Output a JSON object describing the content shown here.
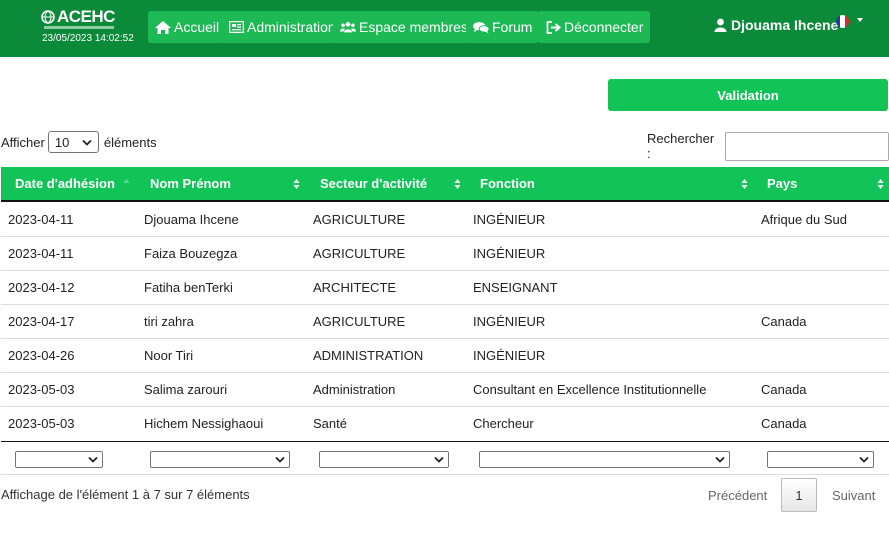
{
  "brand": {
    "name": "ACEHC",
    "datetime": "23/05/2023 14:02:52"
  },
  "nav": {
    "items": [
      {
        "label": "Accueil",
        "icon": "home-icon"
      },
      {
        "label": "Administration",
        "icon": "newspaper-icon"
      },
      {
        "label": "Espace membres",
        "icon": "users-icon"
      },
      {
        "label": "Forum",
        "icon": "comments-icon"
      },
      {
        "label": "Déconnecter",
        "icon": "sign-out-icon"
      }
    ],
    "user_name": "Djouama Ihcene"
  },
  "colors": {
    "navbar": "#0b8a3a",
    "accent": "#12c458",
    "nav_button": "#1db954"
  },
  "validation_label": "Validation",
  "table_controls": {
    "show_prefix": "Afficher",
    "page_length": "10",
    "show_suffix": "éléments",
    "search_label": "Rechercher :",
    "search_value": ""
  },
  "table": {
    "columns": [
      "Date d'adhésion",
      "Nom Prénom",
      "Secteur d'activité",
      "Fonction",
      "Pays"
    ],
    "rows": [
      [
        "2023-04-11",
        "Djouama Ihcene",
        "AGRICULTURE",
        "INGÉNIEUR",
        "Afrique du Sud"
      ],
      [
        "2023-04-11",
        "Faiza Bouzegza",
        "AGRICULTURE",
        "INGÉNIEUR",
        ""
      ],
      [
        "2023-04-12",
        "Fatiha benTerki",
        "ARCHITECTE",
        "ENSEIGNANT",
        ""
      ],
      [
        "2023-04-17",
        "tiri zahra",
        "AGRICULTURE",
        "INGÉNIEUR",
        "Canada"
      ],
      [
        "2023-04-26",
        "Noor Tiri",
        "ADMINISTRATION",
        "INGÉNIEUR",
        ""
      ],
      [
        "2023-05-03",
        "Salima zarouri",
        "Administration",
        "Consultant en Excellence Institutionnelle",
        "Canada"
      ],
      [
        "2023-05-03",
        "Hichem Nessighaoui",
        "Santé",
        "Chercheur",
        "Canada"
      ]
    ]
  },
  "footer": {
    "info": "Affichage de l'élément 1 à 7 sur 7 éléments",
    "previous": "Précédent",
    "current_page": "1",
    "next": "Suivant"
  }
}
